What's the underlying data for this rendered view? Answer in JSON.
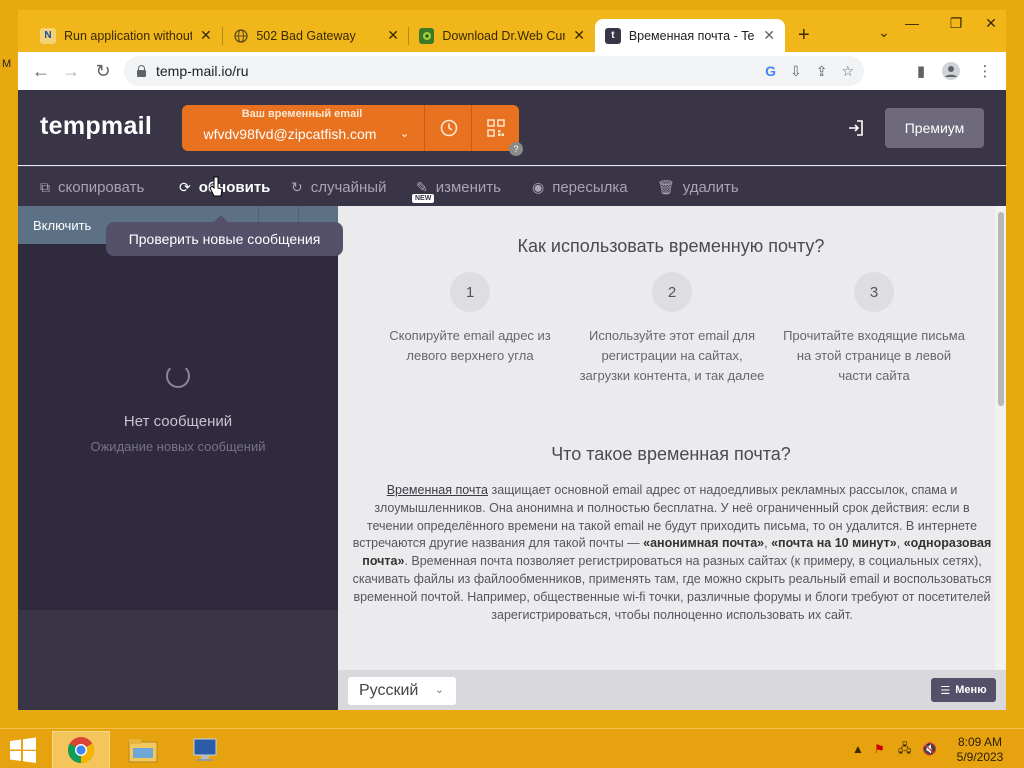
{
  "browser": {
    "tabs": [
      {
        "title": "Run application without",
        "favicon": "N"
      },
      {
        "title": "502 Bad Gateway",
        "favicon": "globe-icon"
      },
      {
        "title": "Download Dr.Web Cure",
        "favicon": "drweb-icon"
      },
      {
        "title": "Временная почта - Ter",
        "favicon": "t"
      }
    ],
    "new_tab": "+",
    "url": "temp-mail.io/ru"
  },
  "page": {
    "logo": "tempmail",
    "email_label": "Ваш временный email",
    "email_address": "wfvdv98fvd@zipcatfish.com",
    "qr_badge": "?",
    "premium_label": "Премиум",
    "actions": {
      "copy": "скопировать",
      "refresh": "обновить",
      "random": "случайный",
      "change": "изменить",
      "change_badge": "NEW",
      "forward": "пересылка",
      "delete": "удалить"
    },
    "tooltip": "Проверить новые сообщения",
    "sidebar": {
      "enable": "Включить",
      "no_messages": "Нет сообщений",
      "waiting": "Ожидание новых сообщений"
    },
    "content": {
      "how_title": "Как использовать временную почту?",
      "steps": [
        {
          "num": "1",
          "text": "Скопируйте email адрес из левого верхнего угла"
        },
        {
          "num": "2",
          "text": "Используйте этот email для регистрации на сайтах, загрузки контента, и так далее"
        },
        {
          "num": "3",
          "text": "Прочитайте входящие письма на этой странице в левой части сайта"
        }
      ],
      "what_title": "Что такое временная почта?",
      "para_link": "Временная почта",
      "para_1": " защищает основной email адрес от надоедливых рекламных рассылок, спама и злоумышленников. Она анонимна и полностью бесплатна. У неё ограниченный срок действия: если в течении определённого времени на такой email не будут приходить письма, то он удалится. В интернете встречаются другие названия для такой почты — ",
      "bold_1": "«анонимная почта»",
      "sep_1": ", ",
      "bold_2": "«почта на 10 минут»",
      "sep_2": ", ",
      "bold_3": "«одноразовая почта»",
      "para_2": ". Временная почта позволяет регистрироваться на разных сайтах (к примеру, в социальных сетях), скачивать файлы из файлообменников, применять там, где можно скрыть реальный email и воспользоваться временной почтой. Например, общественные wi-fi точки, различные форумы и блоги требуют от посетителей зарегистрироваться, чтобы полноценно использовать их сайт."
    },
    "language": "Русский",
    "menu_label": "Меню"
  },
  "taskbar": {
    "time": "8:09 AM",
    "date": "5/9/2023"
  },
  "colors": {
    "header": "#3a3447",
    "sidebar": "#2f2a3d",
    "email_orange": "#e8721f",
    "taskbar": "#e6a20f"
  }
}
